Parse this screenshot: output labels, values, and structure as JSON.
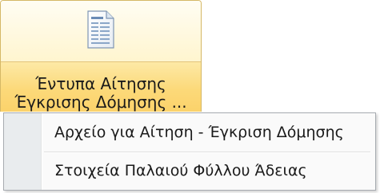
{
  "ribbon_button": {
    "icon": "document-form-icon",
    "label_line1": "Έντυπα Αίτησης",
    "label_line2": "Έγκρισης Δόμησης ..."
  },
  "menu": {
    "items": [
      {
        "label": "Αρχείο για Αίτηση - Έγκριση Δόμησης"
      },
      {
        "label": "Στοιχεία Παλαιού Φύλλου Άδειας"
      }
    ]
  },
  "colors": {
    "highlight_top": "#fffbe9",
    "highlight_bottom": "#fbd26a",
    "border_gold": "#d5b866",
    "menu_gutter": "#e9ecee",
    "menu_border": "#a7abb0"
  }
}
